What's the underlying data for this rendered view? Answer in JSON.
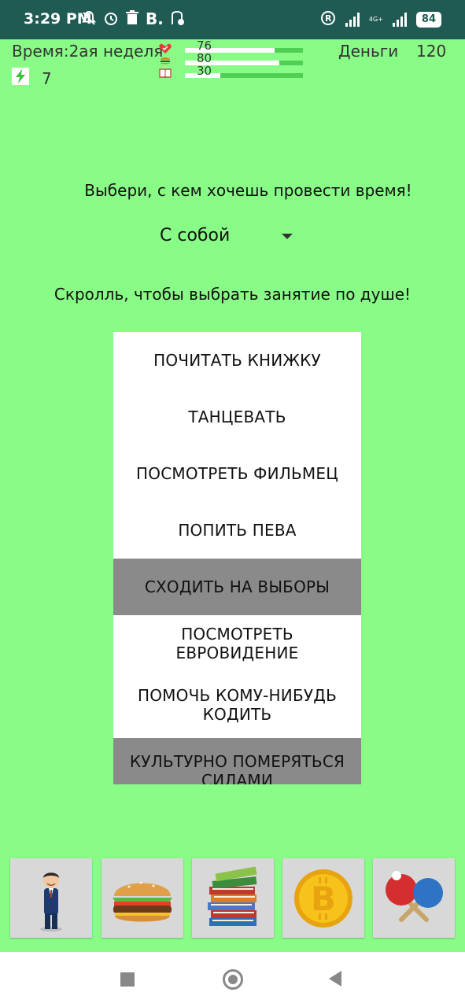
{
  "status_bar": {
    "time": "3:29 PM",
    "carrier_badge": "B.",
    "network_label": "4G+",
    "battery": "84"
  },
  "header": {
    "time_label": "Время:2ая неделя",
    "energy_value": "7",
    "stats": [
      {
        "icon": "heart-icon",
        "value": "76",
        "fill": 0.76
      },
      {
        "icon": "burger-icon",
        "value": "80",
        "fill": 0.8
      },
      {
        "icon": "book-icon",
        "value": "30",
        "fill": 0.3
      }
    ],
    "money_label": "Деньги",
    "money_value": "120"
  },
  "companion": {
    "prompt": "Выбери, с кем хочешь провести время!",
    "selected": "С собой"
  },
  "activities": {
    "hint": "Скролль, чтобы выбрать занятие по душе!",
    "items": [
      {
        "label": "ПОЧИТАТЬ КНИЖКУ",
        "enabled": true
      },
      {
        "label": "ТАНЦЕВАТЬ",
        "enabled": true
      },
      {
        "label": "ПОСМОТРЕТЬ ФИЛЬМЕЦ",
        "enabled": true
      },
      {
        "label": "ПОПИТЬ ПЕВА",
        "enabled": true
      },
      {
        "label": "СХОДИТЬ НА ВЫБОРЫ",
        "enabled": false
      },
      {
        "label": "ПОСМОТРЕТЬ ЕВРОВИДЕНИЕ",
        "enabled": true
      },
      {
        "label": "ПОМОЧЬ КОМУ-НИБУДЬ КОДИТЬ",
        "enabled": true
      },
      {
        "label": "КУЛЬТУРНО ПОМЕРЯТЬСЯ СИЛАМИ",
        "enabled": false
      }
    ]
  },
  "bottom_nav": [
    {
      "icon": "businessman-icon"
    },
    {
      "icon": "burger-icon"
    },
    {
      "icon": "books-icon"
    },
    {
      "icon": "bitcoin-coin-icon"
    },
    {
      "icon": "ping-pong-icon"
    }
  ],
  "colors": {
    "background": "#88fc86",
    "status_bar": "#1f5a53",
    "stat_track": "#4fd054",
    "disabled_item": "#8a8a8a"
  }
}
